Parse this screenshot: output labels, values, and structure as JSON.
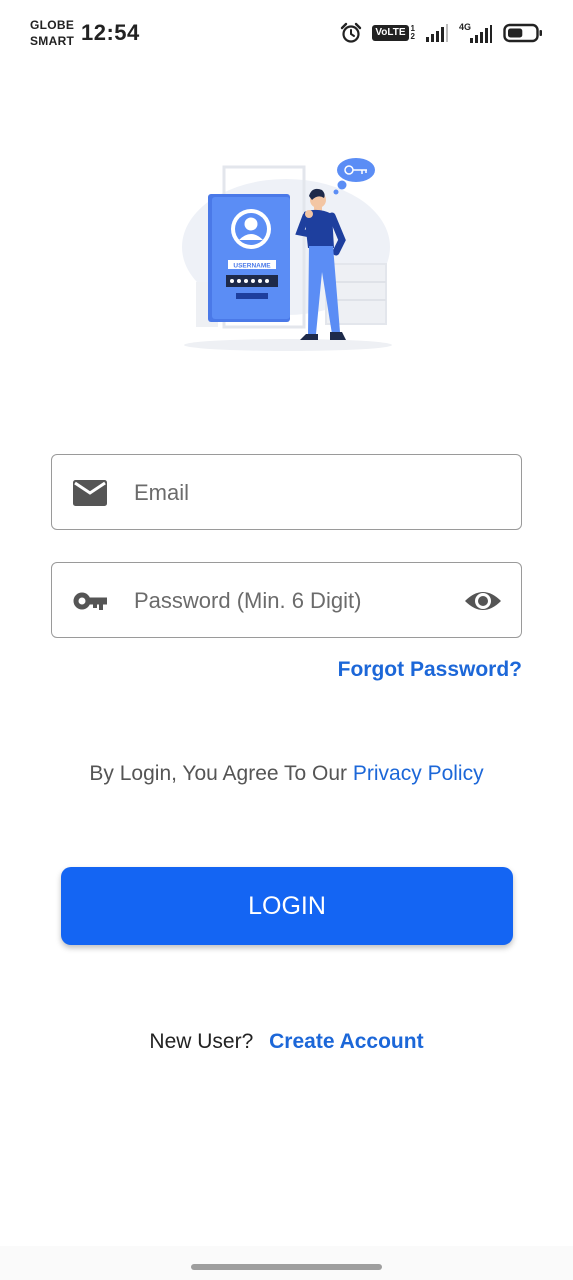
{
  "status_bar": {
    "carrier_line1": "GLOBE",
    "carrier_line2": "SMART",
    "time": "12:54",
    "volte_label": "VoLTE",
    "volte_sim_top": "1",
    "volte_sim_bottom": "2",
    "network_label": "4G",
    "icons": [
      "alarm-icon",
      "volte-icon",
      "signal-icon",
      "4g-signal-icon",
      "battery-icon"
    ],
    "battery_level": 0.55
  },
  "illustration": {
    "card_label": "USERNAME",
    "colors": {
      "primary": "#5b8df5",
      "dark": "#1e2a4a",
      "light": "#eef1f7"
    }
  },
  "form": {
    "email": {
      "placeholder": "Email",
      "value": "",
      "icon": "mail-icon"
    },
    "password": {
      "placeholder": "Password (Min. 6 Digit)",
      "value": "",
      "icon": "key-icon",
      "toggle_icon": "eye-icon"
    },
    "forgot_label": "Forgot Password?",
    "agree_text": "By Login, You Agree To Our",
    "privacy_label": "Privacy Policy",
    "login_label": "LOGIN",
    "new_user_text": "New User?",
    "create_account_label": "Create Account"
  },
  "colors": {
    "accent": "#1465f3",
    "link": "#1c67d8",
    "border": "#9a9a9a"
  }
}
